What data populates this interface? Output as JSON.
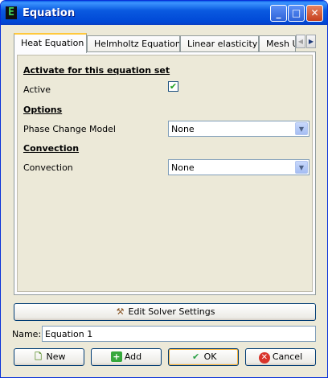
{
  "window": {
    "title": "Equation",
    "app_icon_letter": "E",
    "controls": {
      "minimize": "_",
      "maximize": "□",
      "close": "✕"
    }
  },
  "tabs": [
    {
      "label": "Heat Equation",
      "active": true
    },
    {
      "label": "Helmholtz Equation",
      "active": false
    },
    {
      "label": "Linear elasticity",
      "active": false
    },
    {
      "label": "Mesh Update",
      "active": false
    }
  ],
  "tab_scroll": {
    "left": "◀",
    "right": "▶"
  },
  "panel": {
    "activate_section": "Activate for this equation set",
    "active_label": "Active",
    "active_checked": true,
    "options_section": "Options",
    "phase_change_label": "Phase Change Model",
    "phase_change_value": "None",
    "convection_section": "Convection",
    "convection_label": "Convection",
    "convection_value": "None"
  },
  "buttons": {
    "edit_solver": "Edit Solver Settings",
    "new": "New",
    "add": "Add",
    "ok": "OK",
    "cancel": "Cancel"
  },
  "name_field": {
    "label": "Name:",
    "value": "Equation 1"
  },
  "icons": {
    "edit_solver": "hammer-icon",
    "new": "new-document-icon",
    "add": "plus-icon",
    "ok": "checkmark-icon",
    "cancel": "cancel-icon"
  },
  "colors": {
    "titlebar": "#0a5ae0",
    "dialog_bg": "#ece9d8",
    "active_tab_accent": "#ffc83c",
    "checkmark": "#21a121"
  }
}
